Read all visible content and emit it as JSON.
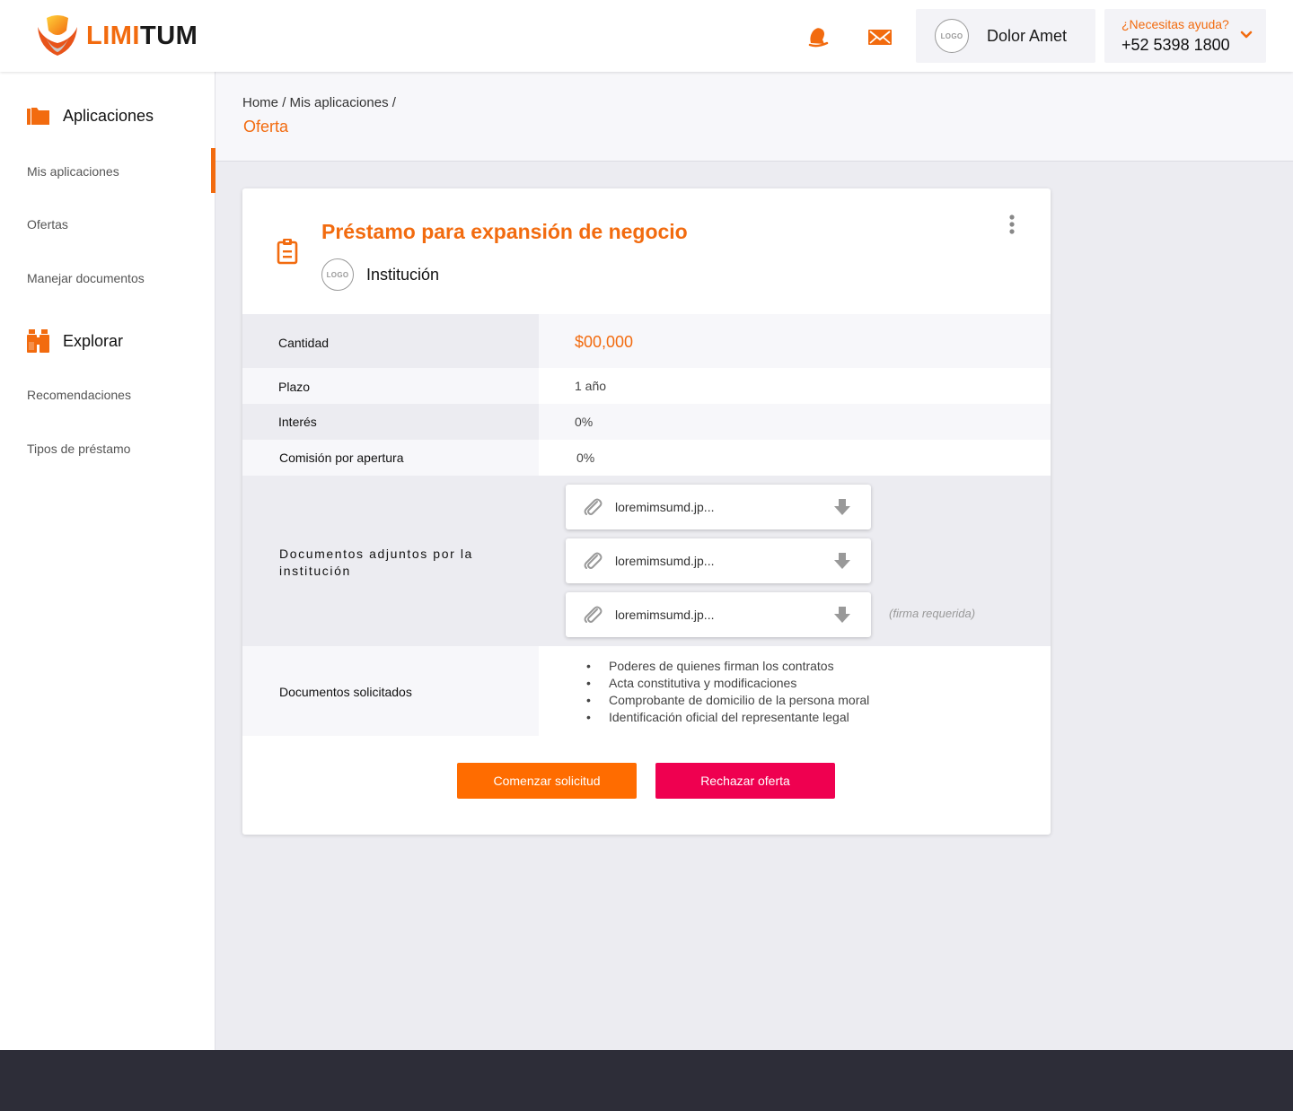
{
  "brand": {
    "name_part1": "LIMI",
    "name_part2": "TUM",
    "accent": "#f26b0f",
    "reject_color": "#ef0050"
  },
  "header": {
    "bell_icon": "bell-icon",
    "mail_icon": "mail-icon",
    "user": {
      "logo_text": "LOGO",
      "name": "Dolor Amet"
    },
    "help": {
      "question": "¿Necesitas ayuda?",
      "phone": "+52 5398 1800"
    }
  },
  "sidebar": {
    "sections": [
      {
        "title": "Aplicaciones",
        "icon": "folder-icon",
        "items": [
          "Mis aplicaciones",
          "Ofertas",
          "Manejar documentos"
        ]
      },
      {
        "title": "Explorar",
        "icon": "binoculars-icon",
        "items": [
          "Recomendaciones",
          "Tipos de préstamo"
        ]
      }
    ],
    "active_item": "Mis aplicaciones"
  },
  "breadcrumb": {
    "path": [
      "Home",
      "Mis aplicaciones"
    ],
    "separator": "/",
    "current": "Oferta"
  },
  "offer": {
    "title": "Préstamo para expansión de negocio",
    "institution_logo": "LOGO",
    "institution": "Institución",
    "rows": [
      {
        "label": "Cantidad",
        "value": "$00,000"
      },
      {
        "label": "Plazo",
        "value": "1 año"
      },
      {
        "label": "Interés",
        "value": "0%"
      },
      {
        "label": "Comisión por apertura",
        "value": "0%"
      }
    ],
    "attachments_label": "Documentos adjuntos por la institución",
    "attachments": [
      {
        "name": "loremimsumd.jp...",
        "note": ""
      },
      {
        "name": "loremimsumd.jp...",
        "note": ""
      },
      {
        "name": "loremimsumd.jp...",
        "note": "(firma requerida)"
      }
    ],
    "requested_label": "Documentos solicitados",
    "requested_docs": [
      "Poderes de quienes firman los contratos",
      "Acta constitutiva y modificaciones",
      "Comprobante de domicilio de la persona moral",
      "Identificación oficial del representante legal"
    ],
    "buttons": {
      "start": "Comenzar solicitud",
      "reject": "Rechazar oferta"
    }
  }
}
